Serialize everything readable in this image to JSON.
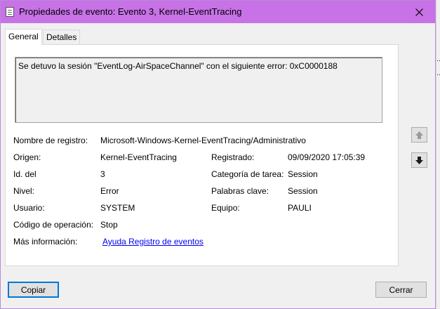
{
  "window": {
    "title": "Propiedades de evento: Evento 3, Kernel-EventTracing"
  },
  "tabs": [
    {
      "label": "General",
      "active": true
    },
    {
      "label": "Detalles",
      "active": false
    }
  ],
  "message": "Se detuvo la sesión \"EventLog-AirSpaceChannel\" con el siguiente error: 0xC0000188",
  "fields": {
    "log_name_label": "Nombre de registro:",
    "log_name_value": "Microsoft-Windows-Kernel-EventTracing/Administrativo",
    "source_label": "Origen:",
    "source_value": "Kernel-EventTracing",
    "logged_label": "Registrado:",
    "logged_value": "09/09/2020 17:05:39",
    "event_id_label": "Id. del",
    "event_id_value": "3",
    "task_category_label": "Categoría de tarea:",
    "task_category_value": "Session",
    "level_label": "Nivel:",
    "level_value": "Error",
    "keywords_label": "Palabras clave:",
    "keywords_value": "Session",
    "user_label": "Usuario:",
    "user_value": "SYSTEM",
    "computer_label": "Equipo:",
    "computer_value": "PAULI",
    "opcode_label": "Código de operación:",
    "opcode_value": "Stop",
    "more_info_label": "Más información:",
    "more_info_link": "Ayuda Registro de eventos"
  },
  "buttons": {
    "copy": "Copiar",
    "close": "Cerrar"
  },
  "icons": {
    "close": "close-icon",
    "up": "arrow-up-icon",
    "down": "arrow-down-icon"
  },
  "colors": {
    "titlebar": "#c772e6",
    "link": "#0000ee",
    "focus_border": "#0078d7"
  }
}
